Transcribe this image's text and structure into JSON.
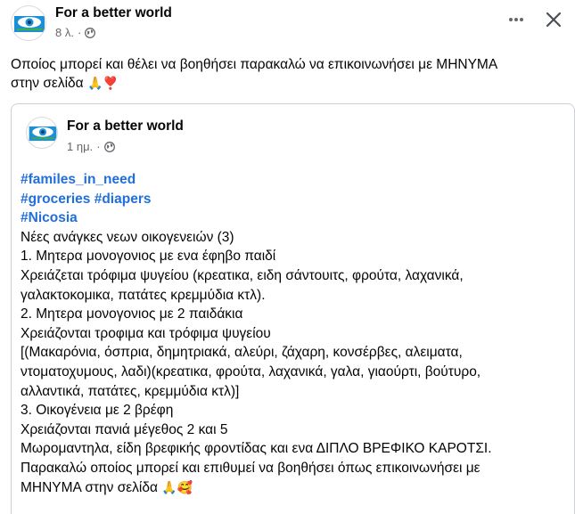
{
  "post": {
    "author": "For a better world",
    "time": "8 λ.",
    "separator": "·",
    "text": "Οποίος μπορεί και θέλει να βοηθήσει παρακαλώ να επικοινωνήσει με ΜΗΝΥΜΑ",
    "text_line2": "στην σελίδα",
    "emojis": "🙏❣️"
  },
  "shared": {
    "author": "For a better world",
    "time": "1 ημ.",
    "separator": "·",
    "hashtags": [
      "#familes_in_need",
      "#groceries #diapers",
      "#Nicosia"
    ],
    "lines": [
      "Νέες ανάγκες νεων οικογενειών (3)",
      "1. Μητερα μονογονιος με ενα έφηβο παιδί",
      "Χρειάζεται τρόφιμα ψυγείου (κρεατικα, ειδη σάντουιτς, φρούτα, λαχανικά,",
      "γαλακτοκομικα, πατάτες κρεμμύδια κτλ).",
      "2. Μητερα μονογονιος με 2 παιδάκια",
      "Χρειάζονται τροφιμα και τρόφιμα ψυγείου",
      "[(Μακαρόνια, όσπρια, δημητριακά, αλεύρι, ζάχαρη, κονσέρβες, αλειματα,",
      "ντοματοχυμους, λαδι)(κρεατικα, φρούτα, λαχανικά, γαλα, γιαούρτι, βούτυρο,",
      "αλλαντικά, πατάτες, κρεμμύδια κτλ)]",
      "3. Οικογένεια με 2 βρέφη",
      "Χρειάζονται πανιά μέγεθος 2 και 5",
      "Μωρομαντηλα, είδη βρεφικής φροντίδας και ενα ΔΙΠΛΟ ΒΡΕΦΙΚΟ ΚΑΡΟΤΣΙ.",
      "Παρακαλώ οποίος μπορεί και επιθυμεί να βοηθήσει όπως επικοινωνήσει με"
    ],
    "last_line": "ΜΗΝΥΜΑ στην σελίδα",
    "last_emojis": "🙏🥰"
  },
  "icons": {
    "avatar": "eye-logo-icon",
    "privacy": "globe-icon",
    "more": "more-dots-icon",
    "close": "close-icon"
  },
  "colors": {
    "hashtag": "#216fdb",
    "meta": "#65676b",
    "logo_blue": "#1d8fd6",
    "logo_green": "#3fae49"
  }
}
